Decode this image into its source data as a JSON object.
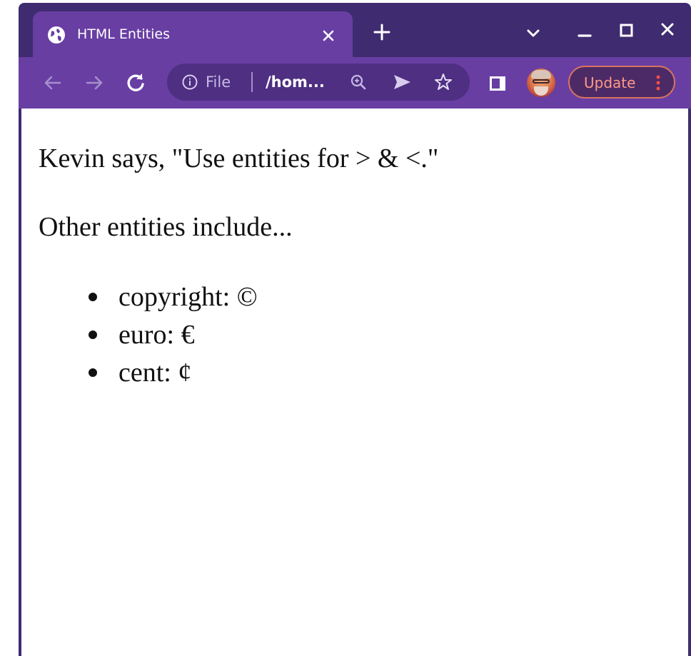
{
  "tab": {
    "title": "HTML Entities",
    "favicon": "globe-icon"
  },
  "toolbar": {
    "omnibox": {
      "scheme": "File",
      "path": "/hom..."
    },
    "update_label": "Update"
  },
  "page": {
    "line1": "Kevin says, \"Use entities for > & <.\"",
    "line2": "Other entities include...",
    "list": [
      "copyright: ©",
      "euro: €",
      "cent: ¢"
    ]
  },
  "colors": {
    "frame": "#3f2c70",
    "active_tab": "#683ea3",
    "omnibox": "#4e2f82",
    "update_accent": "#ff9a86"
  }
}
